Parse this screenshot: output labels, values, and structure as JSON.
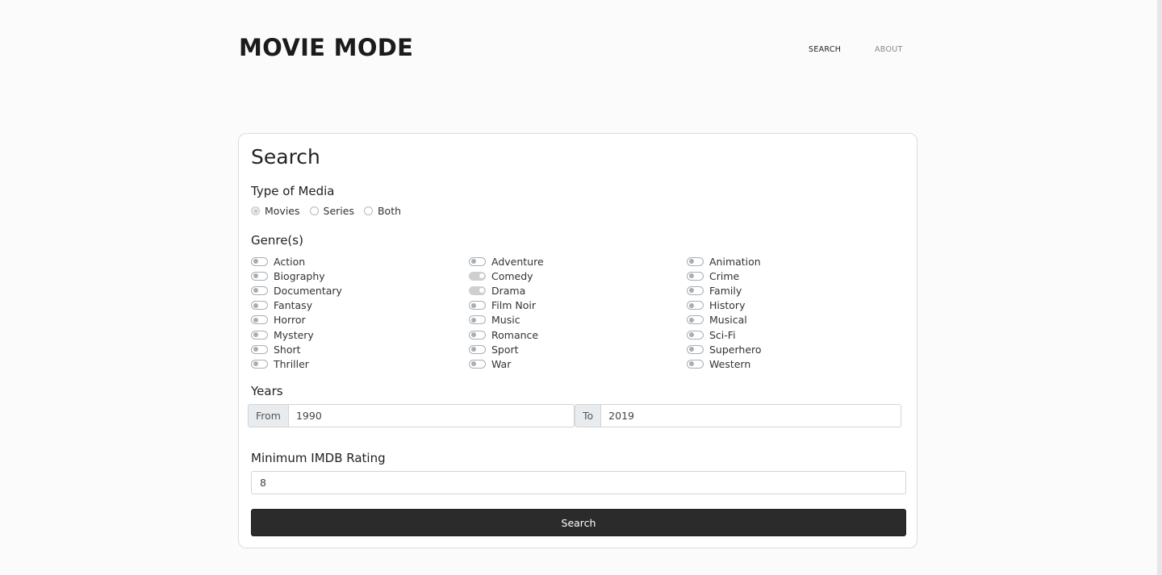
{
  "header": {
    "logo": "MOVIE MODE",
    "nav": {
      "search": "SEARCH",
      "about": "ABOUT"
    }
  },
  "search_form": {
    "title": "Search",
    "media_type": {
      "label": "Type of Media",
      "options": [
        "Movies",
        "Series",
        "Both"
      ],
      "selected": "Movies"
    },
    "genres": {
      "label": "Genre(s)",
      "columns": [
        [
          {
            "name": "Action",
            "on": false
          },
          {
            "name": "Biography",
            "on": false
          },
          {
            "name": "Documentary",
            "on": false
          },
          {
            "name": "Fantasy",
            "on": false
          },
          {
            "name": "Horror",
            "on": false
          },
          {
            "name": "Mystery",
            "on": false
          },
          {
            "name": "Short",
            "on": false
          },
          {
            "name": "Thriller",
            "on": false
          }
        ],
        [
          {
            "name": "Adventure",
            "on": false
          },
          {
            "name": "Comedy",
            "on": true
          },
          {
            "name": "Drama",
            "on": true
          },
          {
            "name": "Film Noir",
            "on": false
          },
          {
            "name": "Music",
            "on": false
          },
          {
            "name": "Romance",
            "on": false
          },
          {
            "name": "Sport",
            "on": false
          },
          {
            "name": "War",
            "on": false
          }
        ],
        [
          {
            "name": "Animation",
            "on": false
          },
          {
            "name": "Crime",
            "on": false
          },
          {
            "name": "Family",
            "on": false
          },
          {
            "name": "History",
            "on": false
          },
          {
            "name": "Musical",
            "on": false
          },
          {
            "name": "Sci-Fi",
            "on": false
          },
          {
            "name": "Superhero",
            "on": false
          },
          {
            "name": "Western",
            "on": false
          }
        ]
      ]
    },
    "years": {
      "label": "Years",
      "from_label": "From",
      "from_value": "1990",
      "to_label": "To",
      "to_value": "2019"
    },
    "rating": {
      "label": "Minimum IMDB Rating",
      "value": "8"
    },
    "submit_label": "Search"
  }
}
